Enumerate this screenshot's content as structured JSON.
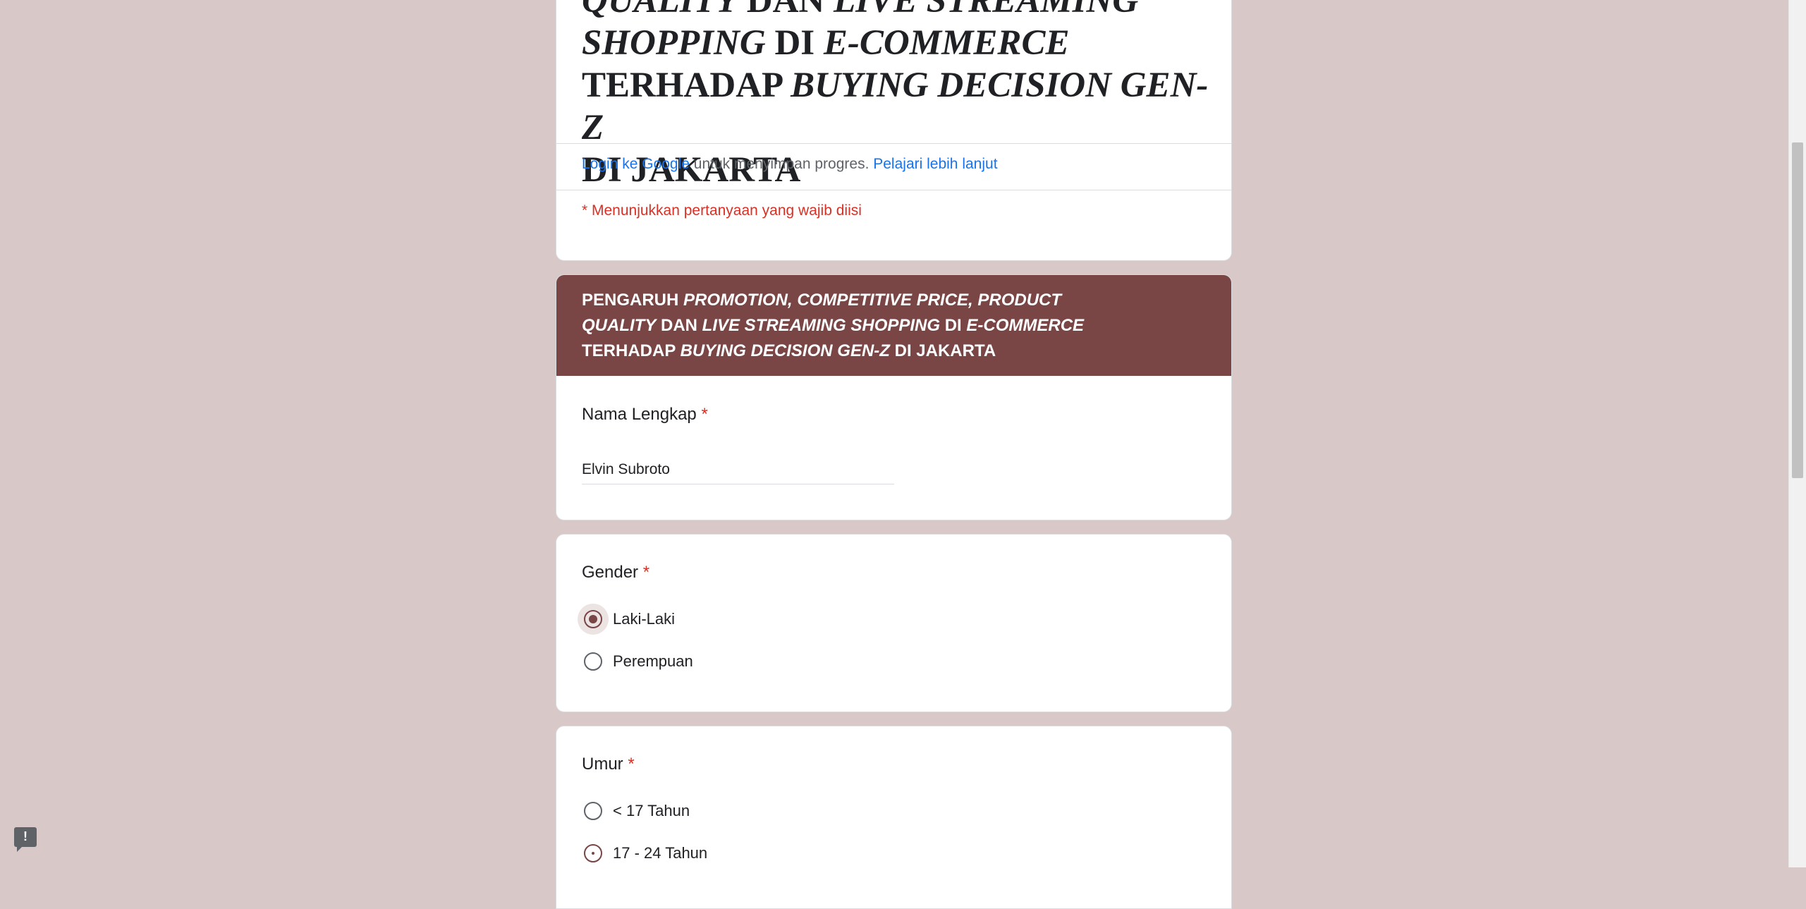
{
  "form": {
    "title_lines": [
      {
        "italic": "QUALITY",
        "normal": " DAN ",
        "italic2": "LIVE STREAMING"
      },
      {
        "italic": "SHOPPING",
        "normal": " DI ",
        "italic2": "E-COMMERCE"
      },
      {
        "normal": "TERHADAP ",
        "italic": "BUYING DECISION GEN-Z"
      },
      {
        "normal": "DI JAKARTA"
      }
    ],
    "login_link": "Login ke Google",
    "login_text": " untuk menyimpan progres. ",
    "learn_more_link": "Pelajari lebih lanjut",
    "required_note": "* Menunjukkan pertanyaan yang wajib diisi"
  },
  "section": {
    "header_parts": [
      {
        "t": "PENGARUH ",
        "i": false
      },
      {
        "t": "PROMOTION, COMPETITIVE PRICE, PRODUCT QUALITY",
        "i": true
      },
      {
        "t": " DAN ",
        "i": false
      },
      {
        "t": "LIVE STREAMING SHOPPING",
        "i": true
      },
      {
        "t": " DI ",
        "i": false
      },
      {
        "t": "E-COMMERCE",
        "i": true
      },
      {
        "t": " TERHADAP ",
        "i": false
      },
      {
        "t": "BUYING DECISION GEN-Z",
        "i": true
      },
      {
        "t": " DI JAKARTA",
        "i": false
      }
    ]
  },
  "questions": {
    "name": {
      "label": "Nama Lengkap",
      "required_mark": "*",
      "value": "Elvin Subroto"
    },
    "gender": {
      "label": "Gender",
      "required_mark": "*",
      "options": [
        "Laki-Laki",
        "Perempuan"
      ],
      "selected": "Laki-Laki"
    },
    "age": {
      "label": "Umur",
      "required_mark": "*",
      "options": [
        "< 17 Tahun",
        "17 - 24 Tahun"
      ],
      "selected": null
    }
  },
  "feedback_icon": "!",
  "colors": {
    "accent": "#794545",
    "background": "#d8c8c8",
    "link": "#1a73e8",
    "required": "#d93025"
  }
}
